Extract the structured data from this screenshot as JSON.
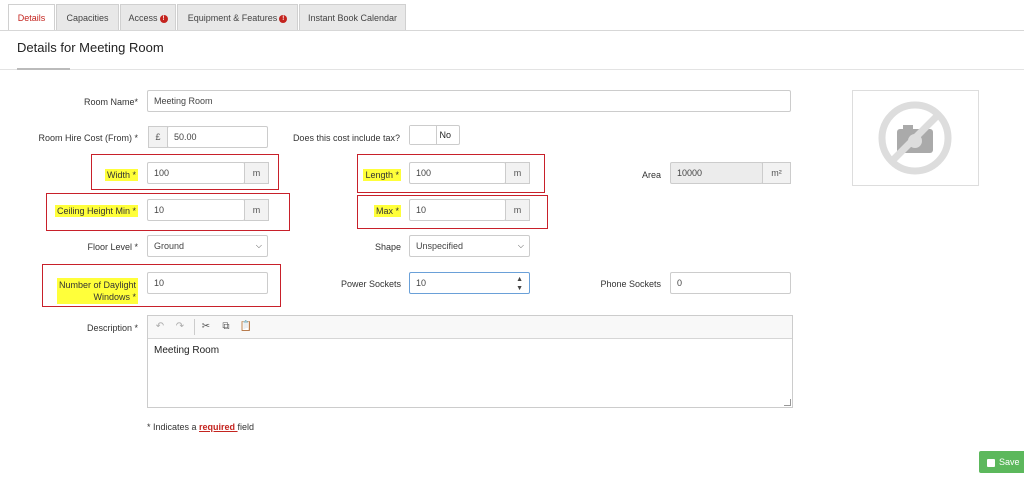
{
  "tabs": [
    {
      "label": "Details",
      "active": true,
      "badge": ""
    },
    {
      "label": "Capacities",
      "active": false,
      "badge": ""
    },
    {
      "label": "Access",
      "active": false,
      "badge": "!"
    },
    {
      "label": "Equipment & Features",
      "active": false,
      "badge": "!"
    },
    {
      "label": "Instant Book Calendar",
      "active": false,
      "badge": ""
    }
  ],
  "page": {
    "title": "Details for Meeting Room"
  },
  "form": {
    "room_name": {
      "label": "Room Name*",
      "value": "Meeting Room"
    },
    "hire_cost": {
      "label": "Room Hire Cost (From) *",
      "currency": "£",
      "value": "50.00"
    },
    "tax": {
      "label": "Does this cost include tax?",
      "toggle": "No"
    },
    "width": {
      "label": "Width *",
      "value": "100",
      "unit": "m"
    },
    "length": {
      "label": "Length *",
      "value": "100",
      "unit": "m"
    },
    "area": {
      "label": "Area",
      "value": "10000",
      "unit": "m²"
    },
    "ceiling_min": {
      "label": "Ceiling Height Min *",
      "value": "10",
      "unit": "m"
    },
    "ceiling_max": {
      "label": "Max *",
      "value": "10",
      "unit": "m"
    },
    "floor_level": {
      "label": "Floor Level *",
      "value": "Ground"
    },
    "shape": {
      "label": "Shape",
      "value": "Unspecified"
    },
    "daylight_windows": {
      "label_line1": "Number of Daylight",
      "label_line2": "Windows *",
      "value": "10"
    },
    "power_sockets": {
      "label": "Power Sockets",
      "value": "10"
    },
    "phone_sockets": {
      "label": "Phone Sockets",
      "value": "0"
    },
    "description": {
      "label": "Description *",
      "value": "Meeting Room"
    }
  },
  "footnote": {
    "prefix": "* Indicates a ",
    "link": "required ",
    "suffix": "field"
  },
  "actions": {
    "save_label": "Save"
  },
  "colors": {
    "accent_red": "#c4241f",
    "highlight": "#ffff3a",
    "save_green": "#5cb85c"
  },
  "icons": {
    "photo": "no-camera-icon",
    "undo": "undo-icon",
    "redo": "redo-icon",
    "cut": "cut-icon",
    "copy": "copy-icon",
    "paste": "paste-icon",
    "save": "floppy-icon"
  }
}
